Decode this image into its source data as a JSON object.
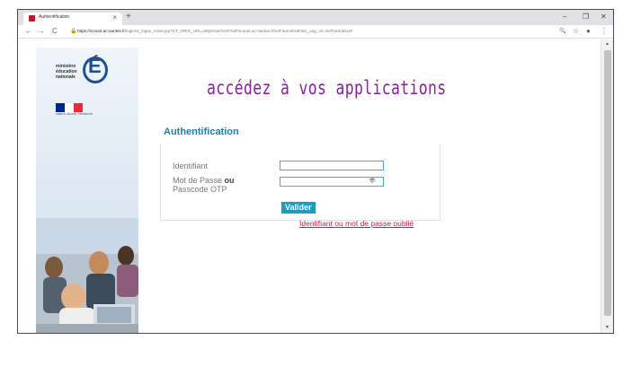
{
  "browser": {
    "tab_title": "Authentification",
    "tab_close": "×",
    "new_tab": "+",
    "window_controls": {
      "minimize": "–",
      "maximize": "❐",
      "close": "✕"
    },
    "nav": {
      "back": "←",
      "forward": "→",
      "reload": "C"
    },
    "url_host": "https://sconet.ac-nantes.fr",
    "url_path": "/login/ct_logon_mixte.jsp?CT_ORIG_URL=https%3A%2F%2Fsconet.ac-nantes.fr%2Farena%2F&ct_orig_uri=%2Farena%2F",
    "toolbar_icons": {
      "zoom": "🔍",
      "star": "☆",
      "account": "●",
      "menu": "⋮"
    }
  },
  "sidebar": {
    "ministere": [
      "ministère",
      "éducation",
      "nationale"
    ],
    "logo_letter": "É",
    "flag_colors": [
      "#002395",
      "#ffffff",
      "#ed2939"
    ],
    "flag_caption": "LIBERTÉ · ÉGALITÉ · FRATERNITÉ"
  },
  "main": {
    "headline": "accédez à vos applications",
    "auth_title": "Authentification",
    "identifiant_label": "Identifiant",
    "password_label": "Mot de Passe",
    "password_or": "ou",
    "passcode_label": "Passcode OTP",
    "identifiant_value": "",
    "password_value": "",
    "eye_icon": "👁",
    "submit_label": "Valider",
    "forgot_link": "Identifiant ou mot de passe oublié"
  },
  "colors": {
    "headline": "#8a1fa0",
    "auth_title": "#1a7fb5",
    "button": "#1a9dc5",
    "link": "#c2185b"
  }
}
